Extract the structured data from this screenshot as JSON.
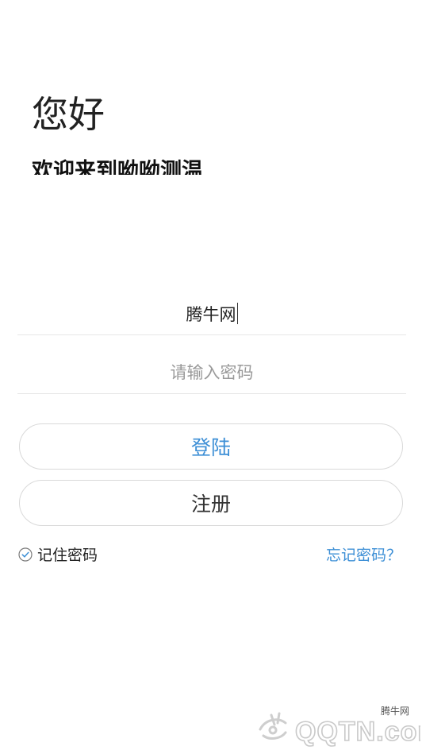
{
  "header": {
    "greeting": "您好",
    "welcome": "欢迎来到呦呦测温"
  },
  "form": {
    "username_value": "腾牛网",
    "password_placeholder": "请输入密码"
  },
  "buttons": {
    "login_label": "登陆",
    "register_label": "注册"
  },
  "options": {
    "remember_label": "记住密码",
    "remember_checked": true,
    "forgot_label": "忘记密码？"
  },
  "watermark": {
    "site_name": "腾牛网",
    "logo_text": "QQTN.com"
  },
  "colors": {
    "accent": "#3d8fd6",
    "text": "#222222",
    "placeholder": "#9a9a9a",
    "divider": "#e6e6e6",
    "button_border": "#d9d9d9"
  },
  "icons": {
    "remember": "check-circle-icon",
    "watermark": "qqtn-logo"
  }
}
